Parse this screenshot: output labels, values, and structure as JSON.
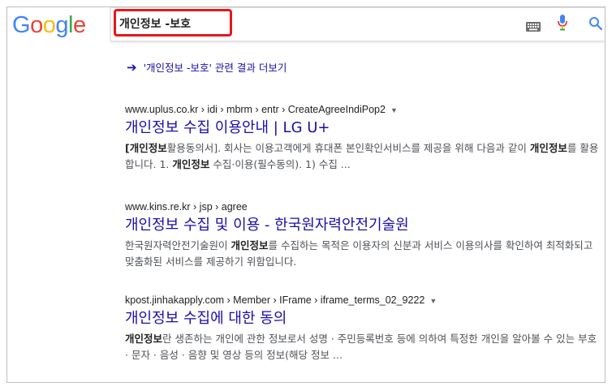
{
  "logo": {
    "letters": [
      {
        "ch": "G",
        "color": "#4285F4"
      },
      {
        "ch": "o",
        "color": "#EA4335"
      },
      {
        "ch": "o",
        "color": "#FBBC05"
      },
      {
        "ch": "g",
        "color": "#4285F4"
      },
      {
        "ch": "l",
        "color": "#34A853"
      },
      {
        "ch": "e",
        "color": "#EA4335"
      }
    ]
  },
  "search": {
    "query": "개인정보 -보호",
    "highlight_color": "#e8161c",
    "icons": [
      "keyboard-icon",
      "microphone-icon",
      "search-icon"
    ]
  },
  "more_results": {
    "text": "'개인정보 -보호' 관련 결과 더보기"
  },
  "results": [
    {
      "url": "www.uplus.co.kr › idi › mbrm › entr › CreateAgreeIndiPop2",
      "has_caret": true,
      "title": "개인정보 수집 이용안내 | LG U+",
      "snippet_parts": [
        {
          "b": true,
          "t": "[개인정보"
        },
        {
          "b": false,
          "t": "활용동의서]. 회사는 이용고객에게 휴대폰 본인확인서비스를 제공을 위해 다음과 같이 "
        },
        {
          "b": true,
          "t": "개인정보"
        },
        {
          "b": false,
          "t": "를 활용합니다. 1. "
        },
        {
          "b": true,
          "t": "개인정보"
        },
        {
          "b": false,
          "t": " 수집·이용(필수동의). 1) 수집 ..."
        }
      ]
    },
    {
      "url": "www.kins.re.kr › jsp › agree",
      "has_caret": false,
      "title": "개인정보 수집 및 이용 - 한국원자력안전기술원",
      "snippet_parts": [
        {
          "b": false,
          "t": "한국원자력안전기술원이 "
        },
        {
          "b": true,
          "t": "개인정보"
        },
        {
          "b": false,
          "t": "를 수집하는 목적은 이용자의 신분과 서비스 이용의사를 확인하여 최적화되고 맞춤화된 서비스를 제공하기 위함입니다."
        }
      ]
    },
    {
      "url": "kpost.jinhakapply.com › Member › IFrame › iframe_terms_02_9222",
      "has_caret": true,
      "title": "개인정보 수집에 대한 동의",
      "snippet_parts": [
        {
          "b": true,
          "t": "개인정보"
        },
        {
          "b": false,
          "t": "란 생존하는 개인에 관한 정보로서 성명 · 주민등록번호 등에 의하여 특정한 개인을 알아볼 수 있는 부호 · 문자 · 음성 · 음향 및 영상 등의 정보(해당 정보 ..."
        }
      ]
    }
  ]
}
